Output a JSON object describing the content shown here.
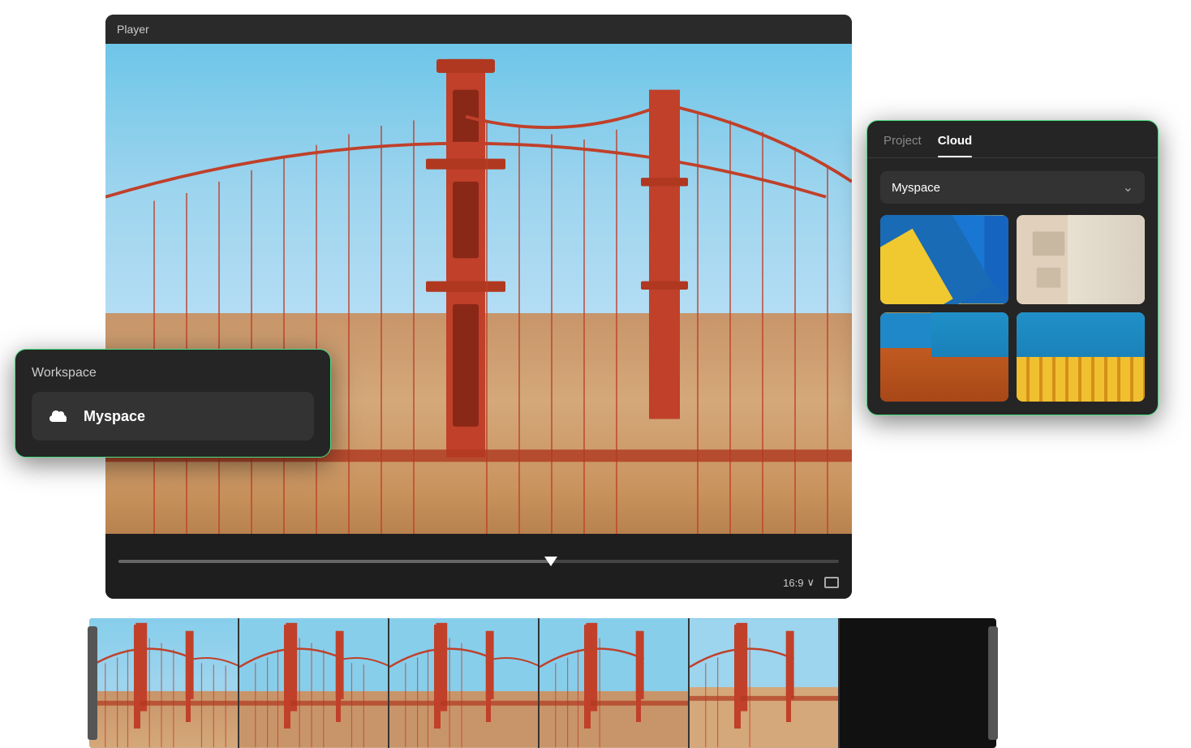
{
  "player": {
    "title": "Player",
    "aspect_ratio": "16:9",
    "aspect_ratio_label": "16:9"
  },
  "workspace_panel": {
    "title": "Workspace",
    "item": {
      "label": "Myspace",
      "icon": "cloud-icon"
    }
  },
  "cloud_panel": {
    "tabs": [
      {
        "label": "Project",
        "active": false
      },
      {
        "label": "Cloud",
        "active": true
      }
    ],
    "dropdown": {
      "label": "Myspace",
      "icon": "chevron-down-icon"
    },
    "thumbnails": [
      {
        "id": 1,
        "alt": "Architecture blue and yellow"
      },
      {
        "id": 2,
        "alt": "Architecture beige building"
      },
      {
        "id": 3,
        "alt": "Architecture orange and blue"
      },
      {
        "id": 4,
        "alt": "Architecture yellow columns and blue"
      }
    ]
  },
  "filmstrip": {
    "frames": [
      1,
      2,
      3,
      4,
      5
    ]
  },
  "colors": {
    "accent_green": "#4ade80",
    "bg_dark": "#252525",
    "bg_darker": "#1e1e1e",
    "text_primary": "#ffffff",
    "text_secondary": "#cccccc",
    "text_muted": "#888888"
  }
}
